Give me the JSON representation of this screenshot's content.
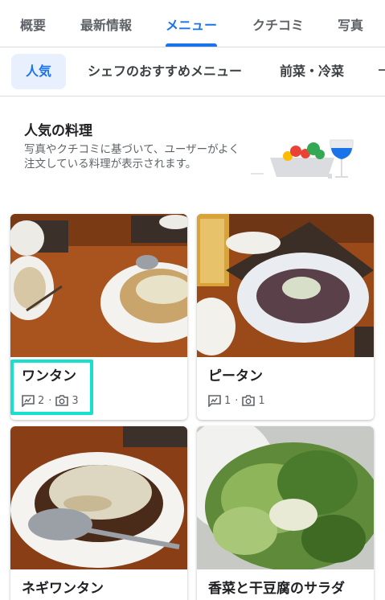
{
  "tabs": [
    "概要",
    "最新情報",
    "メニュー",
    "クチコミ",
    "写真"
  ],
  "chips": [
    "人気",
    "シェフのおすすめメニュー",
    "前菜・冷菜"
  ],
  "section": {
    "title": "人気の料理",
    "description": "写真やクチコミに基づいて、ユーザーがよく注文している料理が表示されます。"
  },
  "dishes": [
    {
      "name": "ワンタン",
      "review_icon": "review-icon",
      "reviews": "2",
      "photo_icon": "camera-icon",
      "photos": "3"
    },
    {
      "name": "ピータン",
      "review_icon": "review-icon",
      "reviews": "1",
      "photo_icon": "camera-icon",
      "photos": "1"
    },
    {
      "name": "ネギワンタン"
    },
    {
      "name": "香菜と干豆腐のサラダ"
    }
  ],
  "separator": "·",
  "colors": {
    "accent": "#1a73e8",
    "highlight": "#17e0cf",
    "chip_bg": "#e8f0fe"
  }
}
